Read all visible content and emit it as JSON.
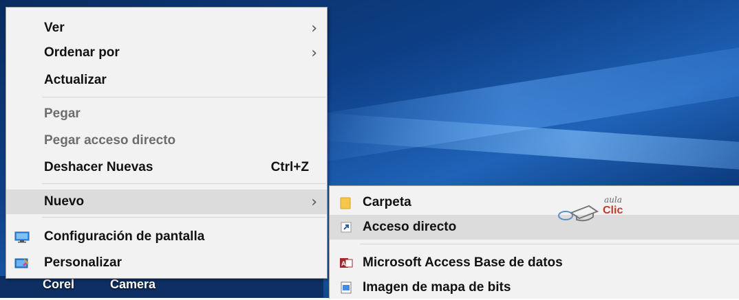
{
  "taskbar": {
    "label1": "Corel",
    "label2": "Camera"
  },
  "context_menu": {
    "items": [
      {
        "label": "Ver",
        "has_submenu": true,
        "disabled": false
      },
      {
        "label": "Ordenar por",
        "has_submenu": true,
        "disabled": false
      },
      {
        "label": "Actualizar",
        "has_submenu": false,
        "disabled": false
      },
      {
        "label": "Pegar",
        "has_submenu": false,
        "disabled": true
      },
      {
        "label": "Pegar acceso directo",
        "has_submenu": false,
        "disabled": true
      },
      {
        "label": "Deshacer Nuevas",
        "shortcut": "Ctrl+Z",
        "disabled": false
      },
      {
        "label": "Nuevo",
        "has_submenu": true,
        "highlighted": true,
        "disabled": false
      },
      {
        "label": "Configuración de pantalla",
        "icon": "display-settings-icon",
        "disabled": false
      },
      {
        "label": "Personalizar",
        "icon": "personalize-icon",
        "disabled": false
      }
    ],
    "arrow_glyph": "›"
  },
  "submenu": {
    "items": [
      {
        "label": "Carpeta",
        "icon": "folder-icon"
      },
      {
        "label": "Acceso directo",
        "icon": "shortcut-icon",
        "highlighted": true
      },
      {
        "label": "Microsoft Access Base de datos",
        "icon": "access-icon"
      },
      {
        "label": "Imagen de mapa de bits",
        "icon": "bitmap-icon"
      }
    ]
  },
  "watermark": {
    "small": "aula",
    "big": "Clic"
  },
  "colors": {
    "menu_bg": "#f2f2f2",
    "highlight": "#dcdcdc",
    "disabled_text": "#6d6d6d",
    "desktop": "#0d3f86"
  }
}
